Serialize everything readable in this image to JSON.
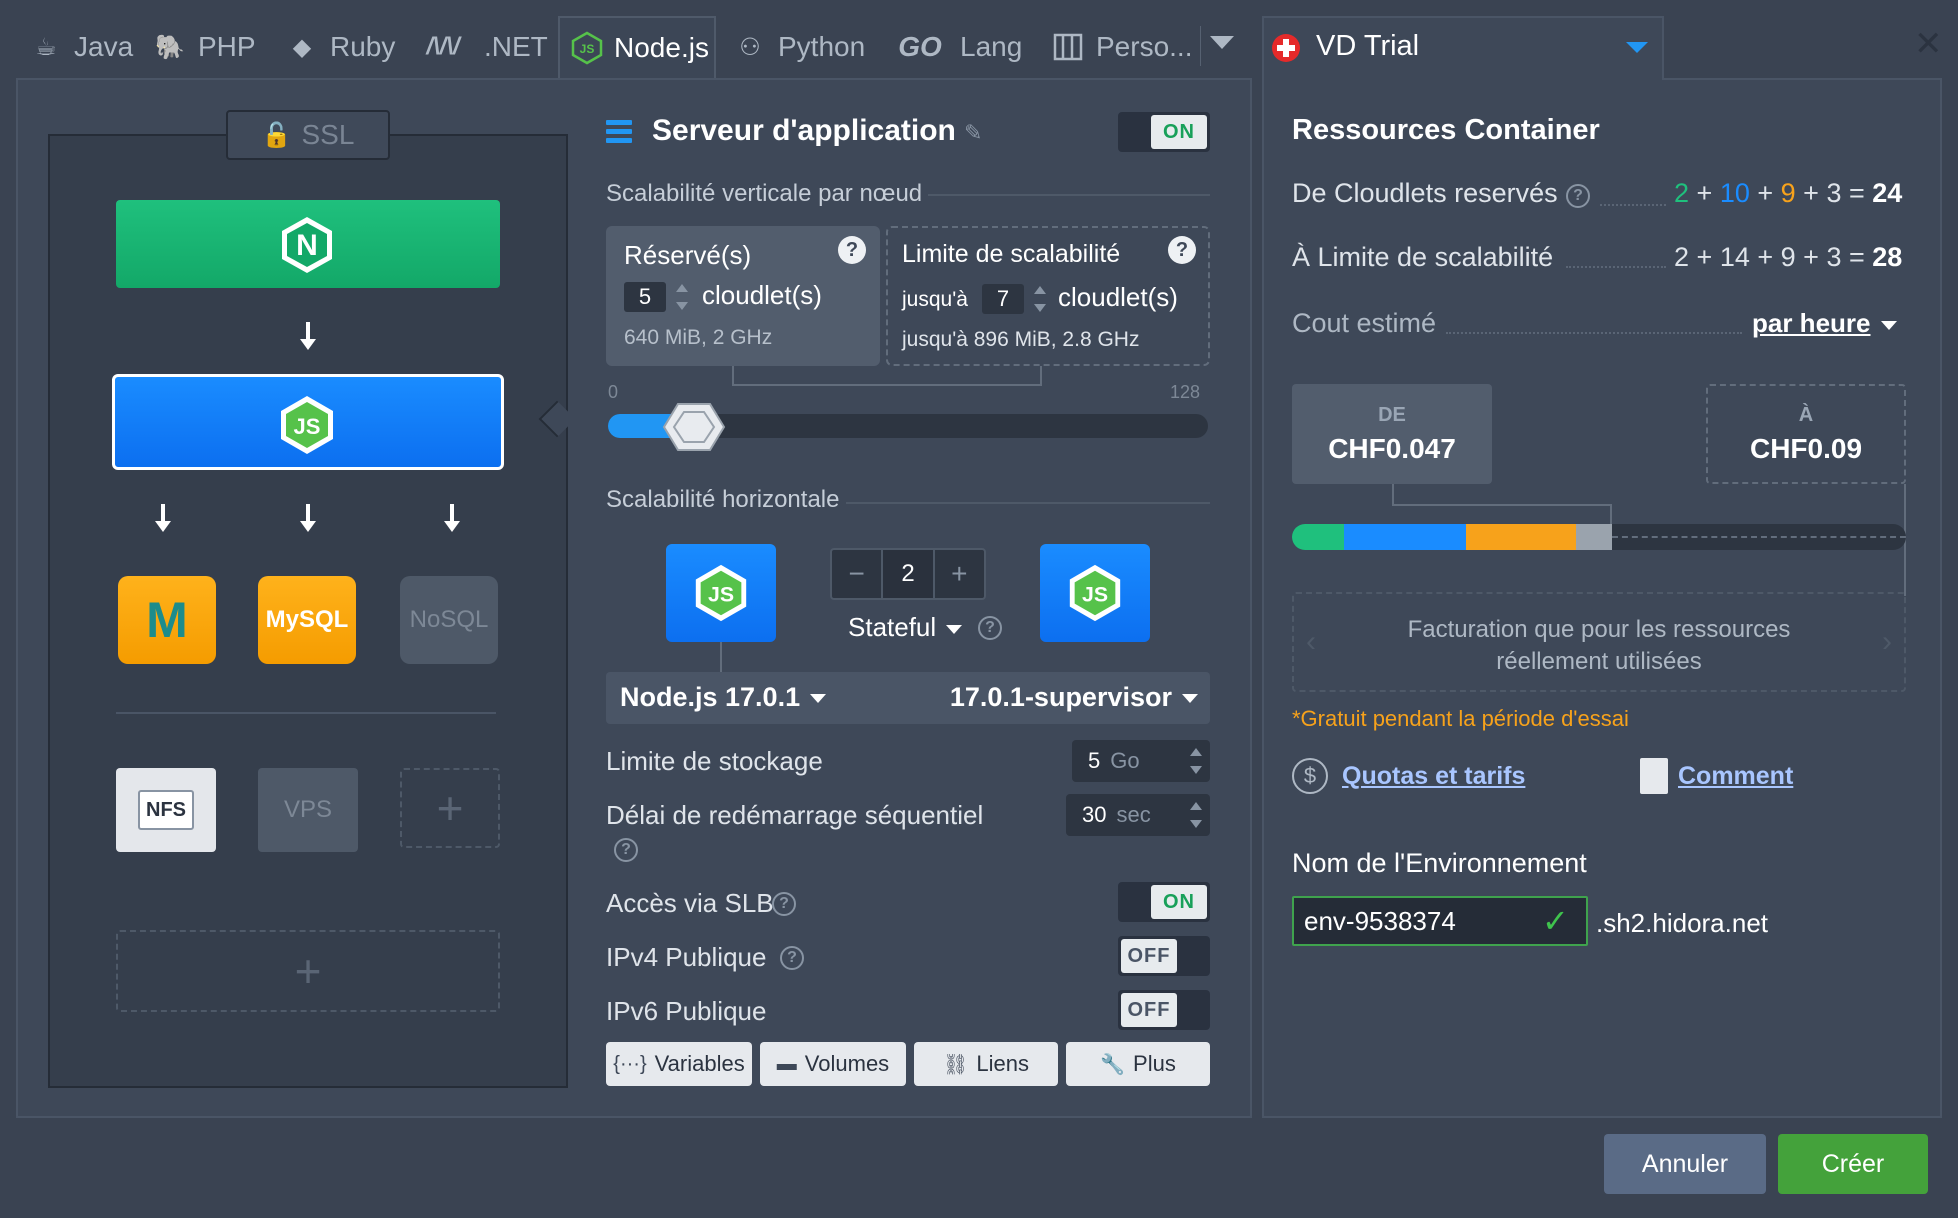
{
  "tabs": [
    {
      "label": "Java",
      "icon": "java-icon"
    },
    {
      "label": "PHP",
      "icon": "php-icon"
    },
    {
      "label": "Ruby",
      "icon": "ruby-icon"
    },
    {
      "label": ".NET",
      "icon": "dotnet-icon"
    },
    {
      "label": "Node.js",
      "icon": "nodejs-icon",
      "active": true
    },
    {
      "label": "Python",
      "icon": "python-icon"
    },
    {
      "label": "Lang",
      "icon": "go-icon",
      "prefix": "GO"
    },
    {
      "label": "Perso...",
      "icon": "custom-icon"
    }
  ],
  "topology": {
    "ssl_label": "SSL",
    "nginx_letter": "N",
    "node_letter": "JS",
    "db": {
      "mariadb_label": "M",
      "mysql_label": "MySQL",
      "nosql_label": "NoSQL"
    },
    "storage": {
      "nfs_label": "NFS",
      "vps_label": "VPS",
      "add_symbol": "+"
    }
  },
  "app_server": {
    "title": "Serveur d'application",
    "enabled_label": "ON",
    "vertical_label": "Scalabilité verticale par nœud",
    "reserved": {
      "title": "Réservé(s)",
      "count": "5",
      "unit": "cloudlet(s)",
      "spec": "640 MiB, 2 GHz"
    },
    "limit": {
      "title": "Limite de scalabilité",
      "prefix": "jusqu'à",
      "count": "7",
      "unit": "cloudlet(s)",
      "spec": "jusqu'à 896 MiB, 2.8 GHz"
    },
    "slider": {
      "min": "0",
      "max": "128",
      "reserved": 5,
      "limit": 7
    },
    "horizontal_label": "Scalabilité horizontale",
    "nodes_count": "2",
    "minus": "−",
    "plus": "+",
    "mode": "Stateful",
    "version": "Node.js 17.0.1",
    "tag": "17.0.1-supervisor",
    "storage_label": "Limite de stockage",
    "storage_value": "5",
    "storage_unit": "Go",
    "restart_label": "Délai de redémarrage séquentiel",
    "restart_value": "30",
    "restart_unit": "sec",
    "slb_label": "Accès via SLB",
    "slb_state": "ON",
    "ipv4_label": "IPv4 Publique",
    "ipv4_state": "OFF",
    "ipv6_label": "IPv6 Publique",
    "ipv6_state": "OFF",
    "buttons": [
      "Variables",
      "Volumes",
      "Liens",
      "Plus"
    ]
  },
  "region": {
    "name": "VD Trial"
  },
  "resources": {
    "title": "Ressources Container",
    "reserved_label": "De Cloudlets reservés",
    "reserved_parts": [
      "2",
      "10",
      "9",
      "3"
    ],
    "reserved_total": "24",
    "limit_label": "À Limite de scalabilité",
    "limit_parts": [
      "2",
      "14",
      "9",
      "3"
    ],
    "limit_total": "28",
    "cost_label": "Cout estimé",
    "period": "par heure",
    "from_label": "DE",
    "from_price": "CHF0.047",
    "to_label": "À",
    "to_price": "CHF0.09",
    "billing_note": "Facturation que pour les ressources réellement utilisées",
    "trial_note": "*Gratuit pendant la période d'essai",
    "quotas_link": "Quotas et tarifs",
    "comment_link": "Comment",
    "colors": {
      "green": "#1fc07d",
      "blue": "#1a8cff",
      "orange": "#f7a21b",
      "gray": "#9aa3ad"
    }
  },
  "environment": {
    "label": "Nom de l'Environnement",
    "name": "env-9538374",
    "domain": ".sh2.hidora.net"
  },
  "footer": {
    "cancel": "Annuler",
    "create": "Créer"
  }
}
